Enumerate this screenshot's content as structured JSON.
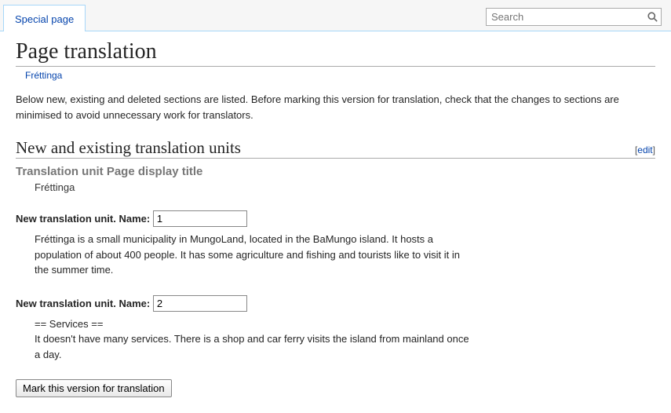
{
  "tab_label": "Special page",
  "search_placeholder": "Search",
  "page_title": "Page translation",
  "page_subtitle": "Fréttinga",
  "intro_text": "Below new, existing and deleted sections are listed. Before marking this version for translation, check that the changes to sections are minimised to avoid unnecessary work for translators.",
  "section_heading": "New and existing translation units",
  "edit_label": "edit",
  "display_title_unit": {
    "label": "Translation unit Page display title",
    "value": "Fréttinga"
  },
  "new_unit_label": "New translation unit. Name:",
  "units": [
    {
      "name": "1",
      "content": "Fréttinga is a small municipality in MungoLand, located in the BaMungo island. It hosts a population of about 400 people. It has some agriculture and fishing and tourists like to visit it in the summer time."
    },
    {
      "name": "2",
      "content": "== Services ==\nIt doesn't have many services. There is a shop and car ferry visits the island from mainland once a day."
    }
  ],
  "mark_button_label": "Mark this version for translation"
}
